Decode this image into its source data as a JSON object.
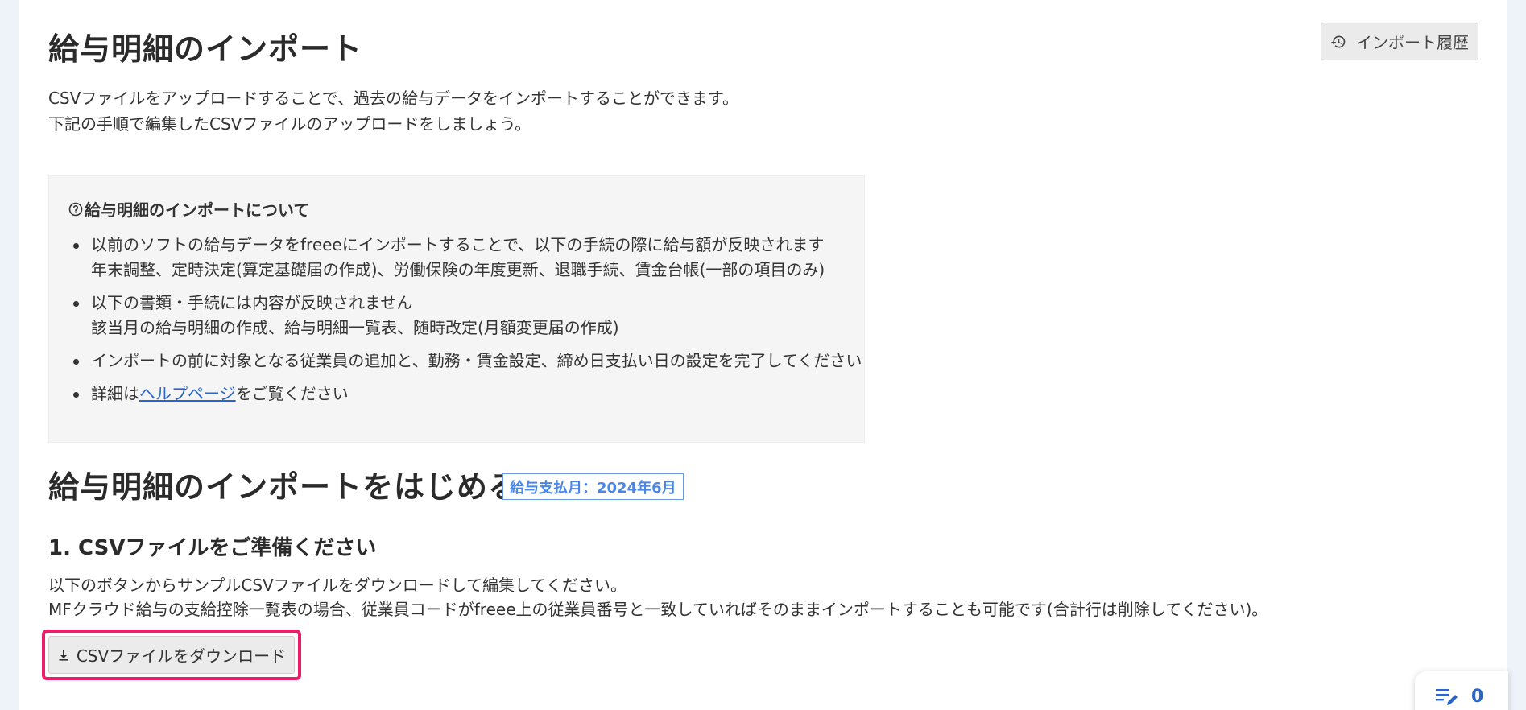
{
  "header": {
    "title": "給与明細のインポート",
    "history_button": "インポート履歴"
  },
  "intro": {
    "line1": "CSVファイルをアップロードすることで、過去の給与データをインポートすることができます。",
    "line2": "下記の手順で編集したCSVファイルのアップロードをしましょう。"
  },
  "info_box": {
    "title": "給与明細のインポートについて",
    "item1_line1": "以前のソフトの給与データをfreeeにインポートすることで、以下の手続の際に給与額が反映されます",
    "item1_line2": "年末調整、定時決定(算定基礎届の作成)、労働保険の年度更新、退職手続、賃金台帳(一部の項目のみ)",
    "item2_line1": "以下の書類・手続には内容が反映されません",
    "item2_line2": "該当月の給与明細の作成、給与明細一覧表、随時改定(月額変更届の作成)",
    "item3": "インポートの前に対象となる従業員の追加と、勤務・賃金設定、締め日支払い日の設定を完了してください",
    "item4_prefix": "詳細は",
    "item4_link": "ヘルプページ",
    "item4_suffix": "をご覧ください"
  },
  "section": {
    "title": "給与明細のインポートをはじめる",
    "badge": "給与支払月：2024年6月"
  },
  "step1": {
    "title": "1. CSVファイルをご準備ください",
    "desc1": "以下のボタンからサンプルCSVファイルをダウンロードして編集してください。",
    "desc2": "MFクラウド給与の支給控除一覧表の場合、従業員コードがfreee上の従業員番号と一致していればそのままインポートすることも可能です(合計行は削除してください)。",
    "download_button": "CSVファイルをダウンロード"
  },
  "float_panel": {
    "count": "0",
    "icon": "edit-list-icon"
  },
  "colors": {
    "background": "#eef2f9",
    "link": "#2a66c8",
    "badge": "#4a86e8",
    "highlight": "#ee1c6a"
  }
}
